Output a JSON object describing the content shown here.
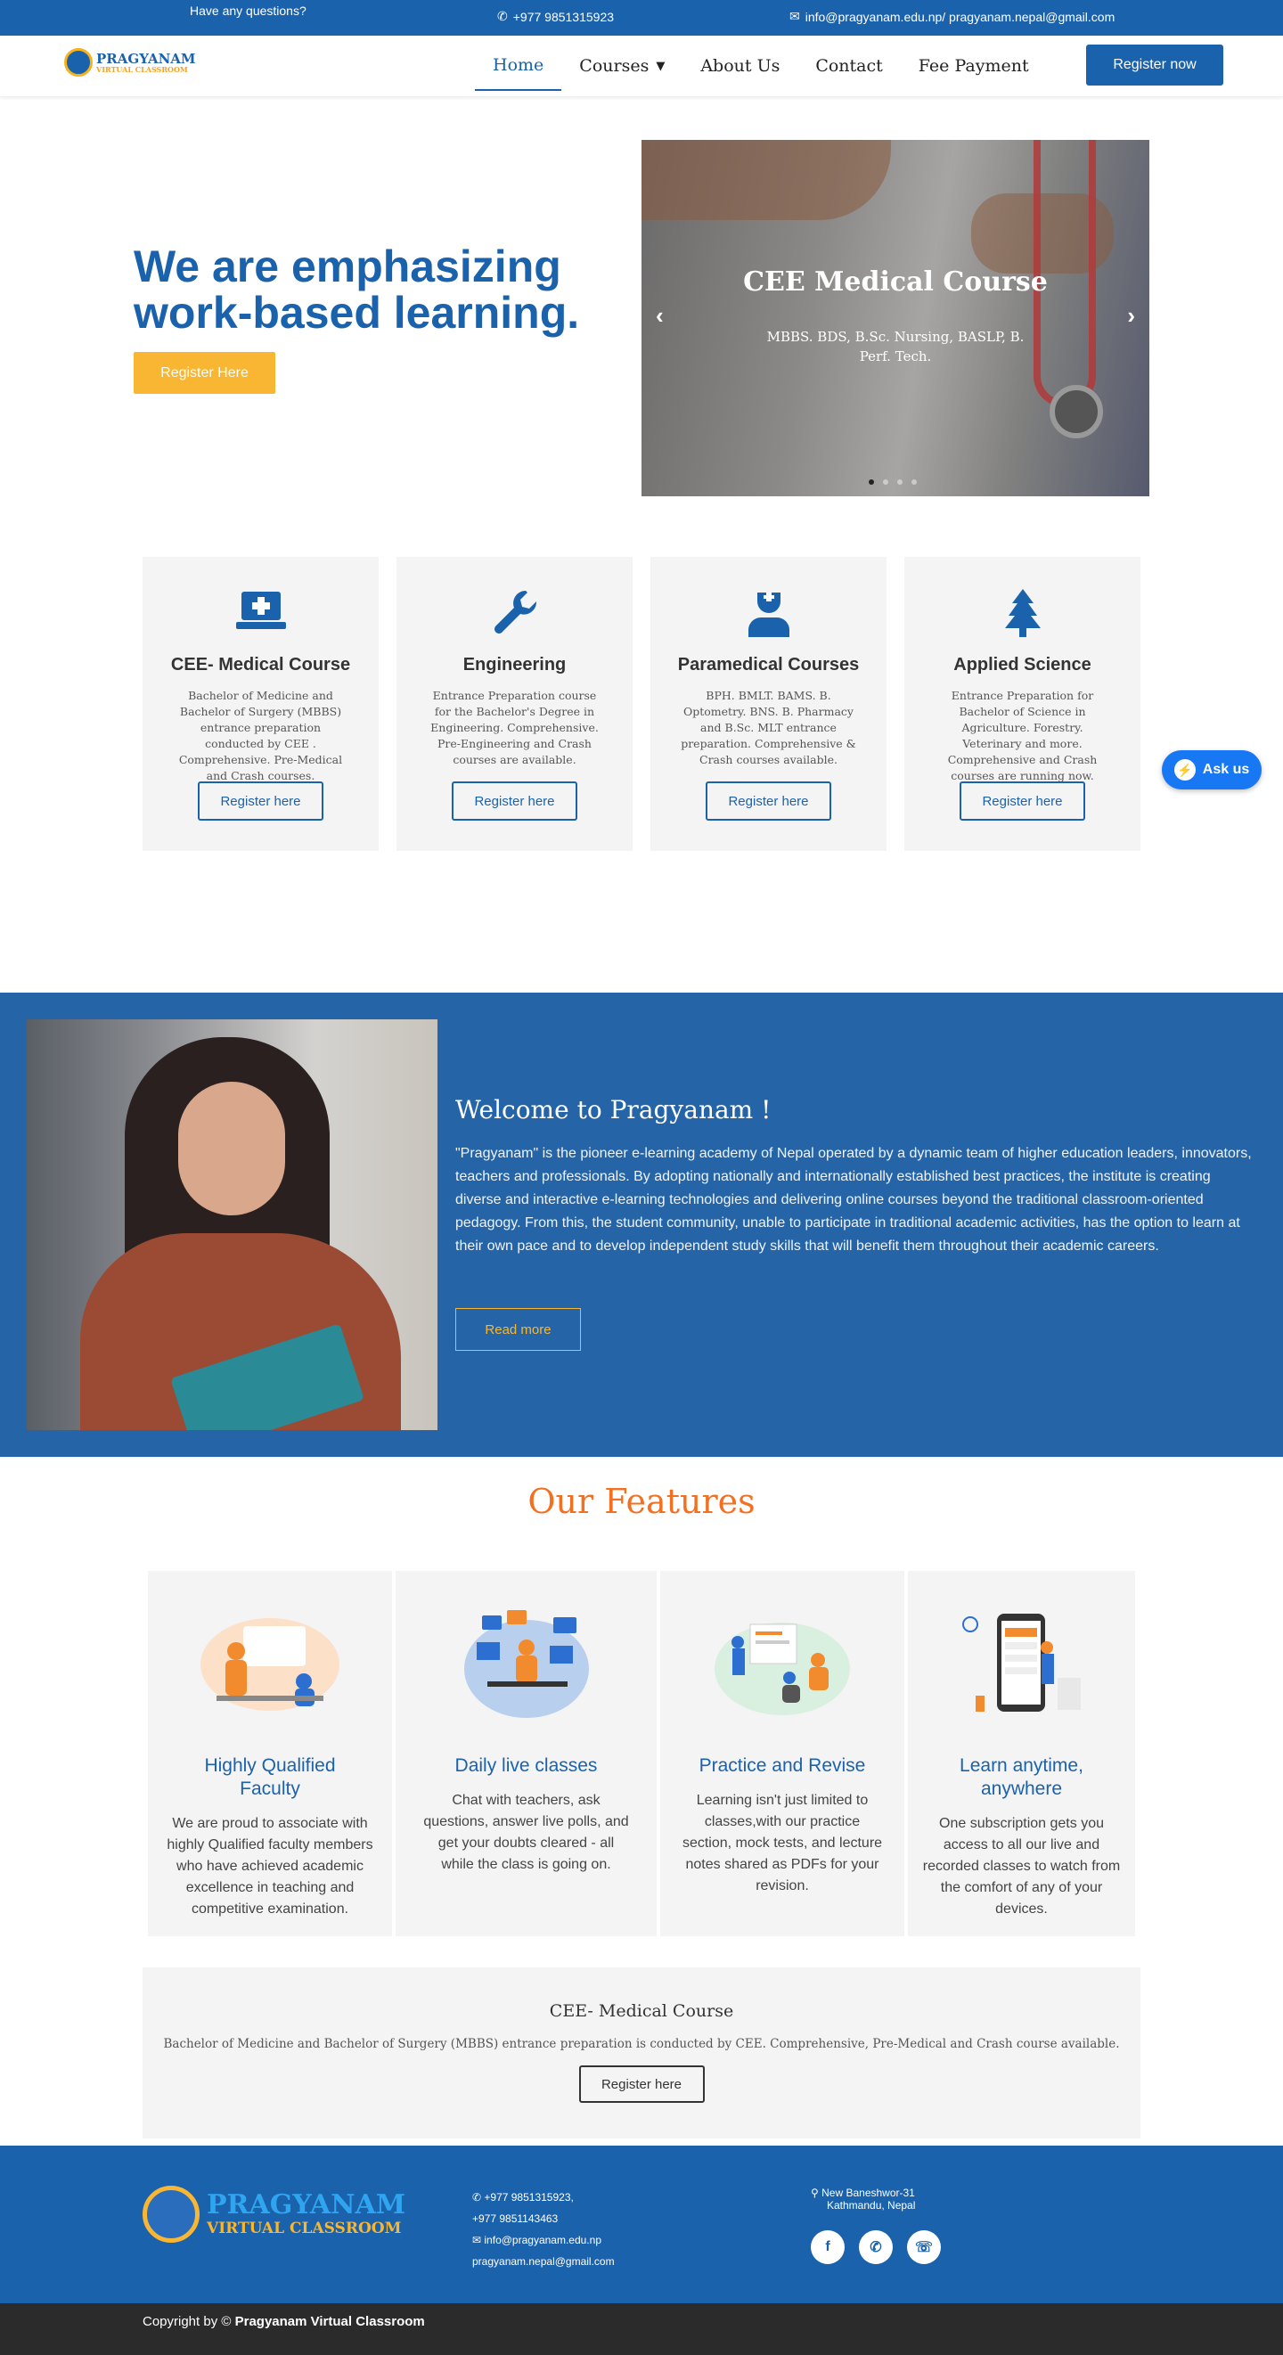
{
  "topbar": {
    "question": "Have any questions?",
    "phone": "+977 9851315923",
    "email": "info@pragyanam.edu.np/ pragyanam.nepal@gmail.com"
  },
  "nav": {
    "logo_line1": "PRAGYANAM",
    "logo_line2": "VIRTUAL CLASSROOM",
    "items": [
      {
        "label": "Home",
        "active": true
      },
      {
        "label": "Courses"
      },
      {
        "label": "About Us"
      },
      {
        "label": "Contact"
      },
      {
        "label": "Fee Payment"
      }
    ],
    "cta": "Register now"
  },
  "hero": {
    "headline": "We are emphasizing work-based learning.",
    "button": "Register Here",
    "slide": {
      "title": "CEE Medical Course",
      "text": "MBBS. BDS, B.Sc. Nursing, BASLP, B. Perf. Tech.",
      "slide_count": 4,
      "active_slide": 1
    }
  },
  "courses": [
    {
      "title": "CEE- Medical Course",
      "icon": "medical-laptop-icon",
      "text": "Bachelor of Medicine and Bachelor of Surgery (MBBS) entrance preparation conducted by CEE . Comprehensive. Pre-Medical and Crash courses.",
      "button": "Register here"
    },
    {
      "title": "Engineering",
      "icon": "wrench-icon",
      "text": "Entrance Preparation course for the Bachelor's Degree in Engineering. Comprehensive. Pre-Engineering and Crash courses are available.",
      "button": "Register here"
    },
    {
      "title": "Paramedical Courses",
      "icon": "nurse-icon",
      "text": "BPH. BMLT. BAMS. B. Optometry. BNS. B. Pharmacy and B.Sc. MLT entrance preparation. Comprehensive & Crash courses available.",
      "button": "Register here"
    },
    {
      "title": "Applied Science",
      "icon": "tree-icon",
      "text": "Entrance Preparation for Bachelor of Science in Agriculture. Forestry. Veterinary and more. Comprehensive and Crash courses are running now.",
      "button": "Register here"
    }
  ],
  "messenger": {
    "label": "Ask us"
  },
  "welcome": {
    "title": "Welcome to Pragyanam !",
    "text": "\"Pragyanam\" is the pioneer e-learning academy of Nepal operated by a dynamic team of higher education leaders, innovators, teachers and professionals. By adopting nationally and internationally established best practices, the institute is creating diverse and interactive e-learning technologies and delivering online courses beyond the traditional classroom-oriented pedagogy. From this, the student community, unable to participate in traditional academic activities, has the option to learn at their own pace and to develop independent study skills that will benefit them throughout their academic careers.",
    "button": "Read more"
  },
  "features": {
    "title": "Our Features",
    "items": [
      {
        "title": "Highly Qualified Faculty",
        "text": "We are proud to associate with highly Qualified faculty members who have achieved academic excellence in teaching and competitive examination."
      },
      {
        "title": "Daily live classes",
        "text": "Chat with teachers, ask questions, answer live polls, and get your doubts cleared - all while the class is going on."
      },
      {
        "title": "Practice and Revise",
        "text": "Learning isn't just limited to classes,with our practice section, mock tests, and lecture notes shared as PDFs for your revision."
      },
      {
        "title": "Learn anytime, anywhere",
        "text": "One subscription gets you access to all our live and recorded classes to watch from the comfort of any of your devices."
      }
    ]
  },
  "cee_banner": {
    "title": "CEE- Medical Course",
    "text": "Bachelor of Medicine and Bachelor of Surgery (MBBS) entrance preparation is conducted by CEE. Comprehensive, Pre-Medical and Crash course available.",
    "button": "Register here"
  },
  "footer": {
    "logo_line1": "PRAGYANAM",
    "logo_line2": "VIRTUAL CLASSROOM",
    "phone1": "+977 9851315923,",
    "phone2": "+977 9851143463",
    "email1": "info@pragyanam.edu.np",
    "email2": "pragyanam.nepal@gmail.com",
    "address1": "New Baneshwor-31",
    "address2": "Kathmandu, Nepal",
    "copyright_prefix": "Copyright by ©",
    "copyright_name": "Pragyanam Virtual Classroom"
  },
  "colors": {
    "primary": "#1b62ad",
    "accent": "#f8b632",
    "features_title": "#f37021",
    "welcome_bg": "#2565a7",
    "copyright_bg": "#2b2b2b"
  }
}
